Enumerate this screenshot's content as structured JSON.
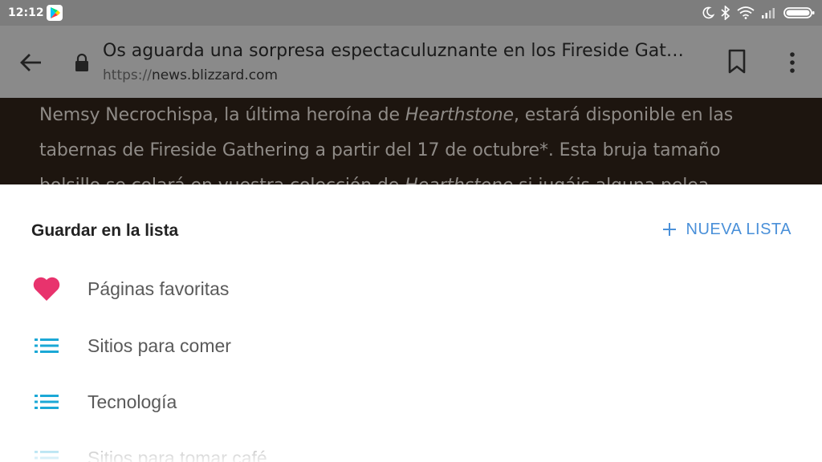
{
  "status_bar": {
    "time": "12:12",
    "icons": [
      "google-play-icon",
      "moon-icon",
      "bluetooth-icon",
      "wifi-icon",
      "signal-icon",
      "battery-icon"
    ]
  },
  "toolbar": {
    "page_title": "Os aguarda una sorpresa espectaculuznante en los Fireside Gat…",
    "url_scheme": "https://",
    "url_host": "news.blizzard.com",
    "icons": [
      "back-arrow-icon",
      "lock-icon",
      "bookmark-icon",
      "more-vert-icon"
    ]
  },
  "article": {
    "line1_pre": "Nemsy Necrochispa, la última heroína de ",
    "line1_em": "Hearthstone",
    "line1_post": ", estará disponible en las",
    "line2": "tabernas de Fireside Gathering a partir del 17 de octubre*. Esta bruja tamaño",
    "line3_pre": "bolsillo se colará en vuestra colección de ",
    "line3_em": "Hearthstone",
    "line3_post": " si jugáis alguna pelea"
  },
  "sheet": {
    "title": "Guardar en la lista",
    "new_list_label": "NUEVA LISTA",
    "items": [
      {
        "label": "Páginas favoritas",
        "icon": "heart-icon"
      },
      {
        "label": "Sitios para comer",
        "icon": "list-icon"
      },
      {
        "label": "Tecnología",
        "icon": "list-icon"
      },
      {
        "label": "Sitios para tomar café",
        "icon": "list-icon"
      }
    ]
  },
  "colors": {
    "accent_blue": "#4a90d9",
    "heart_pink": "#e8336d",
    "list_icon_cyan": "#1ba8d6",
    "status_bar_bg": "#7d7d7d",
    "toolbar_bg": "#8a8a8a",
    "page_bg_dim": "#1d150f"
  }
}
